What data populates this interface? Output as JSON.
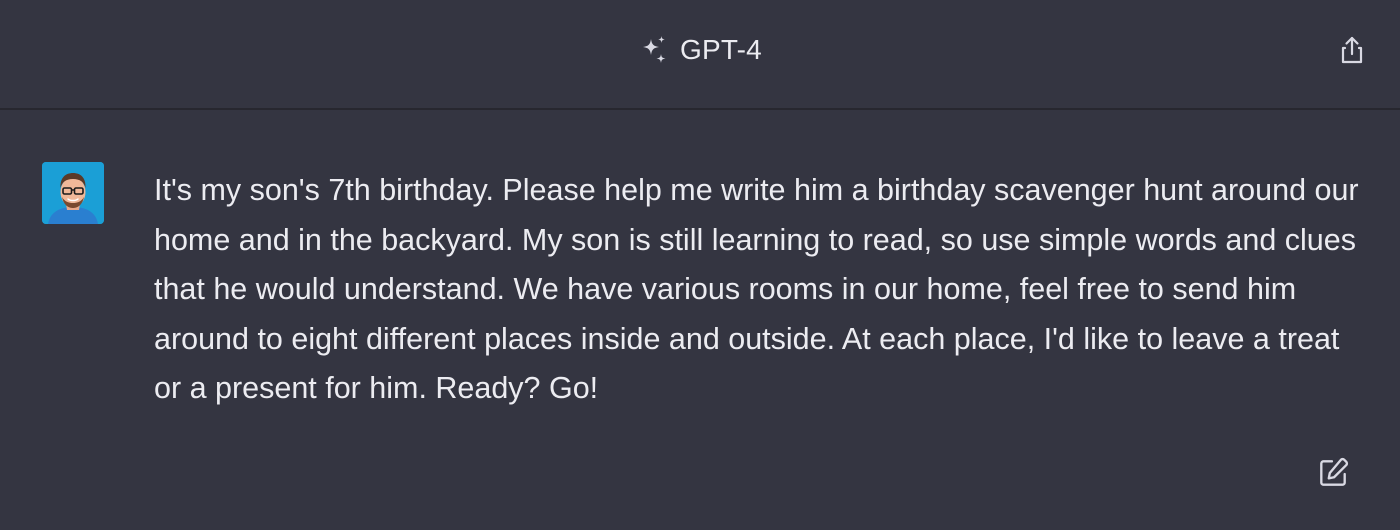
{
  "header": {
    "model_name": "GPT-4",
    "model_icon": "sparkle-icon",
    "share_icon": "share-icon"
  },
  "message": {
    "role": "user",
    "avatar_icon": "user-avatar",
    "text": "It's my son's 7th birthday. Please help me write him a birthday scavenger hunt around our home and in the backyard. My son is still learning to read, so use simple words and clues that he would understand. We have various rooms in our home, feel free to send him around to eight different places inside and outside. At each place, I'd like to leave a treat or a present for him. Ready? Go!",
    "edit_icon": "edit-icon"
  },
  "colors": {
    "background": "#343541",
    "header_divider": "#27272f",
    "text": "#ececf1",
    "icon": "#d9d9e3"
  }
}
